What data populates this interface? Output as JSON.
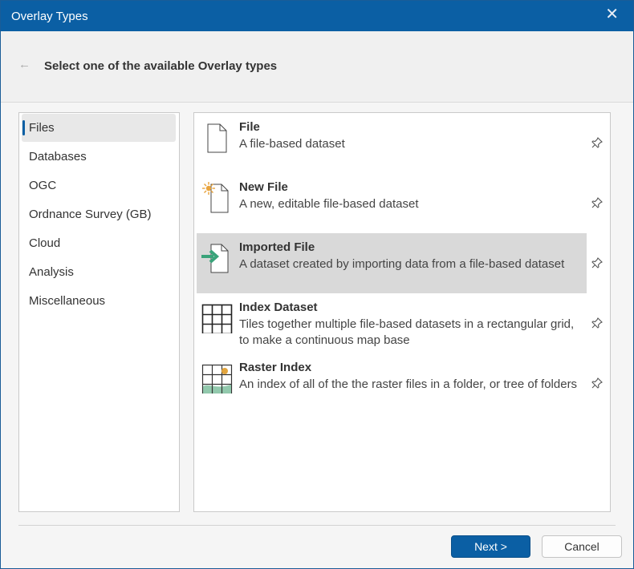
{
  "window": {
    "title": "Overlay Types",
    "close_glyph": "✕"
  },
  "header": {
    "back_glyph": "←",
    "heading": "Select one of the available Overlay types"
  },
  "categories": [
    {
      "label": "Files",
      "selected": true
    },
    {
      "label": "Databases"
    },
    {
      "label": "OGC"
    },
    {
      "label": "Ordnance Survey (GB)"
    },
    {
      "label": "Cloud"
    },
    {
      "label": "Analysis"
    },
    {
      "label": "Miscellaneous"
    }
  ],
  "overlay_types": [
    {
      "name": "File",
      "description": "A file-based dataset",
      "icon": "file-icon"
    },
    {
      "name": "New File",
      "description": "A new, editable file-based dataset",
      "icon": "new-file-icon"
    },
    {
      "name": "Imported File",
      "description": "A dataset created by importing data from a file-based dataset",
      "icon": "imported-file-icon",
      "selected": true
    },
    {
      "name": "Index Dataset",
      "description": "Tiles together multiple file-based datasets in a rectangular grid, to make a continuous map base",
      "icon": "index-grid-icon"
    },
    {
      "name": "Raster Index",
      "description": "An index of all of the the raster files in a folder, or tree of folders",
      "icon": "raster-index-icon"
    }
  ],
  "buttons": {
    "next": "Next >",
    "cancel": "Cancel"
  },
  "colors": {
    "accent": "#0b5fa4",
    "selection": "#d9d9d9",
    "import_arrow": "#3aa37a",
    "new_star": "#e8a33c"
  }
}
